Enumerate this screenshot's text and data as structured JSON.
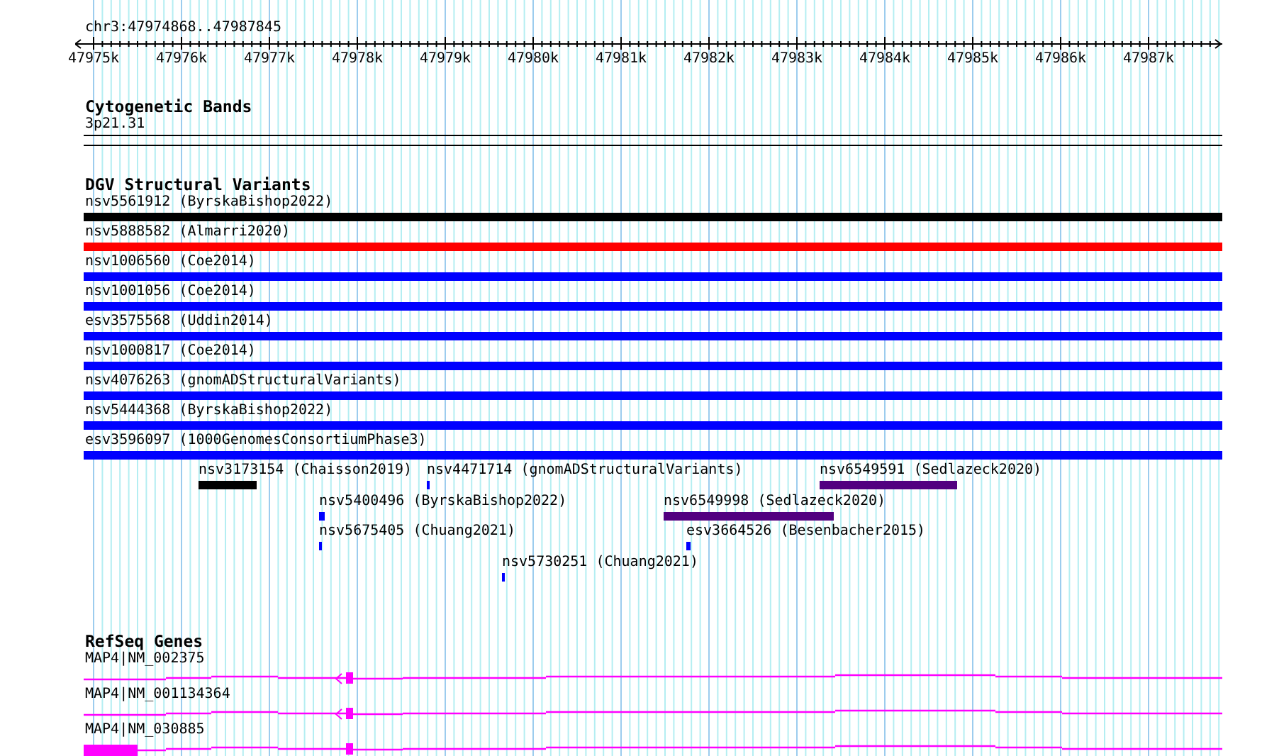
{
  "ruler": {
    "region": "chr3:47974868..47987845",
    "ticks": [
      "47975k",
      "47976k",
      "47977k",
      "47978k",
      "47979k",
      "47980k",
      "47981k",
      "47982k",
      "47983k",
      "47984k",
      "47985k",
      "47986k",
      "47987k"
    ]
  },
  "cytoband_track": {
    "title": "Cytogenetic Bands",
    "band": "3p21.31"
  },
  "dgv_track": {
    "title": "DGV Structural Variants",
    "full_rows": [
      {
        "label": "nsv5561912 (ByrskaBishop2022)",
        "color": "#000000"
      },
      {
        "label": "nsv5888582 (Almarri2020)",
        "color": "#ff0000"
      },
      {
        "label": "nsv1006560 (Coe2014)",
        "color": "#0000ff"
      },
      {
        "label": "nsv1001056 (Coe2014)",
        "color": "#0000ff"
      },
      {
        "label": "esv3575568 (Uddin2014)",
        "color": "#0000ff"
      },
      {
        "label": "nsv1000817 (Coe2014)",
        "color": "#0000ff"
      },
      {
        "label": "nsv4076263 (gnomADStructuralVariants)",
        "color": "#0000ff"
      },
      {
        "label": "nsv5444368 (ByrskaBishop2022)",
        "color": "#0000ff"
      },
      {
        "label": "esv3596097 (1000GenomesConsortiumPhase3)",
        "color": "#0000ff"
      }
    ],
    "features": [
      {
        "label": "nsv3173154 (Chaisson2019)",
        "color": "#000000"
      },
      {
        "label": "nsv4471714 (gnomADStructuralVariants)",
        "color": "#0000ff"
      },
      {
        "label": "nsv6549591 (Sedlazeck2020)",
        "color": "#520080"
      },
      {
        "label": "nsv5400496 (ByrskaBishop2022)",
        "color": "#0000ff"
      },
      {
        "label": "nsv6549998 (Sedlazeck2020)",
        "color": "#520080"
      },
      {
        "label": "nsv5675405 (Chuang2021)",
        "color": "#0000ff"
      },
      {
        "label": "esv3664526 (Besenbacher2015)",
        "color": "#0000ff"
      },
      {
        "label": "nsv5730251 (Chuang2021)",
        "color": "#0000ff"
      }
    ]
  },
  "refseq_track": {
    "title": "RefSeq Genes",
    "genes": [
      {
        "label": "MAP4|NM_002375",
        "kind": "arrow"
      },
      {
        "label": "MAP4|NM_001134364",
        "kind": "arrow"
      },
      {
        "label": "MAP4|NM_030885",
        "kind": "block"
      }
    ]
  }
}
